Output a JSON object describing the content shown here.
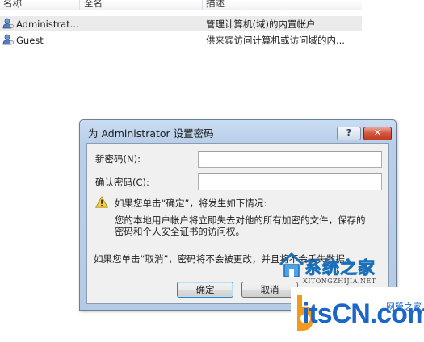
{
  "user_list": {
    "columns": [
      "名称",
      "全名",
      "描述"
    ],
    "rows": [
      {
        "name": "Administrat...",
        "fullname": "",
        "description": "管理计算机(域)的内置帐户",
        "icon": "user-icon"
      },
      {
        "name": "Guest",
        "fullname": "",
        "description": "供来宾访问计算机或访问域的内...",
        "icon": "user-icon"
      }
    ]
  },
  "dialog": {
    "title": "为 Administrator 设置密码",
    "help_label": "?",
    "close_label": "✕",
    "new_password_label": "新密码(N):",
    "confirm_password_label": "确认密码(C):",
    "warning_line1": "如果您单击“确定”，将发生如下情况:",
    "warning_line2": "您的本地用户帐户将立即失去对他的所有加密的文件，保存的",
    "warning_line3": "密码和个人安全证书的访问权。",
    "cancel_note": "如果您单击“取消”，密码将不会被更改，并且将不会丢失数据。",
    "ok_label": "确定",
    "cancel_label": "取消",
    "warning_icon": "warning-icon"
  },
  "watermarks": {
    "site1_name": "系统之家",
    "site1_url": "XITONGZHIJIA.NET",
    "site2_name": "itsCN.com",
    "site2_tag": "网管之家"
  },
  "colors": {
    "dialog_frame": "#b9cfe9",
    "close_button": "#c23a22",
    "default_button_border": "#3c7fb1",
    "watermark_blue": "#1a67c9",
    "watermark_orange": "#f39a1e"
  }
}
